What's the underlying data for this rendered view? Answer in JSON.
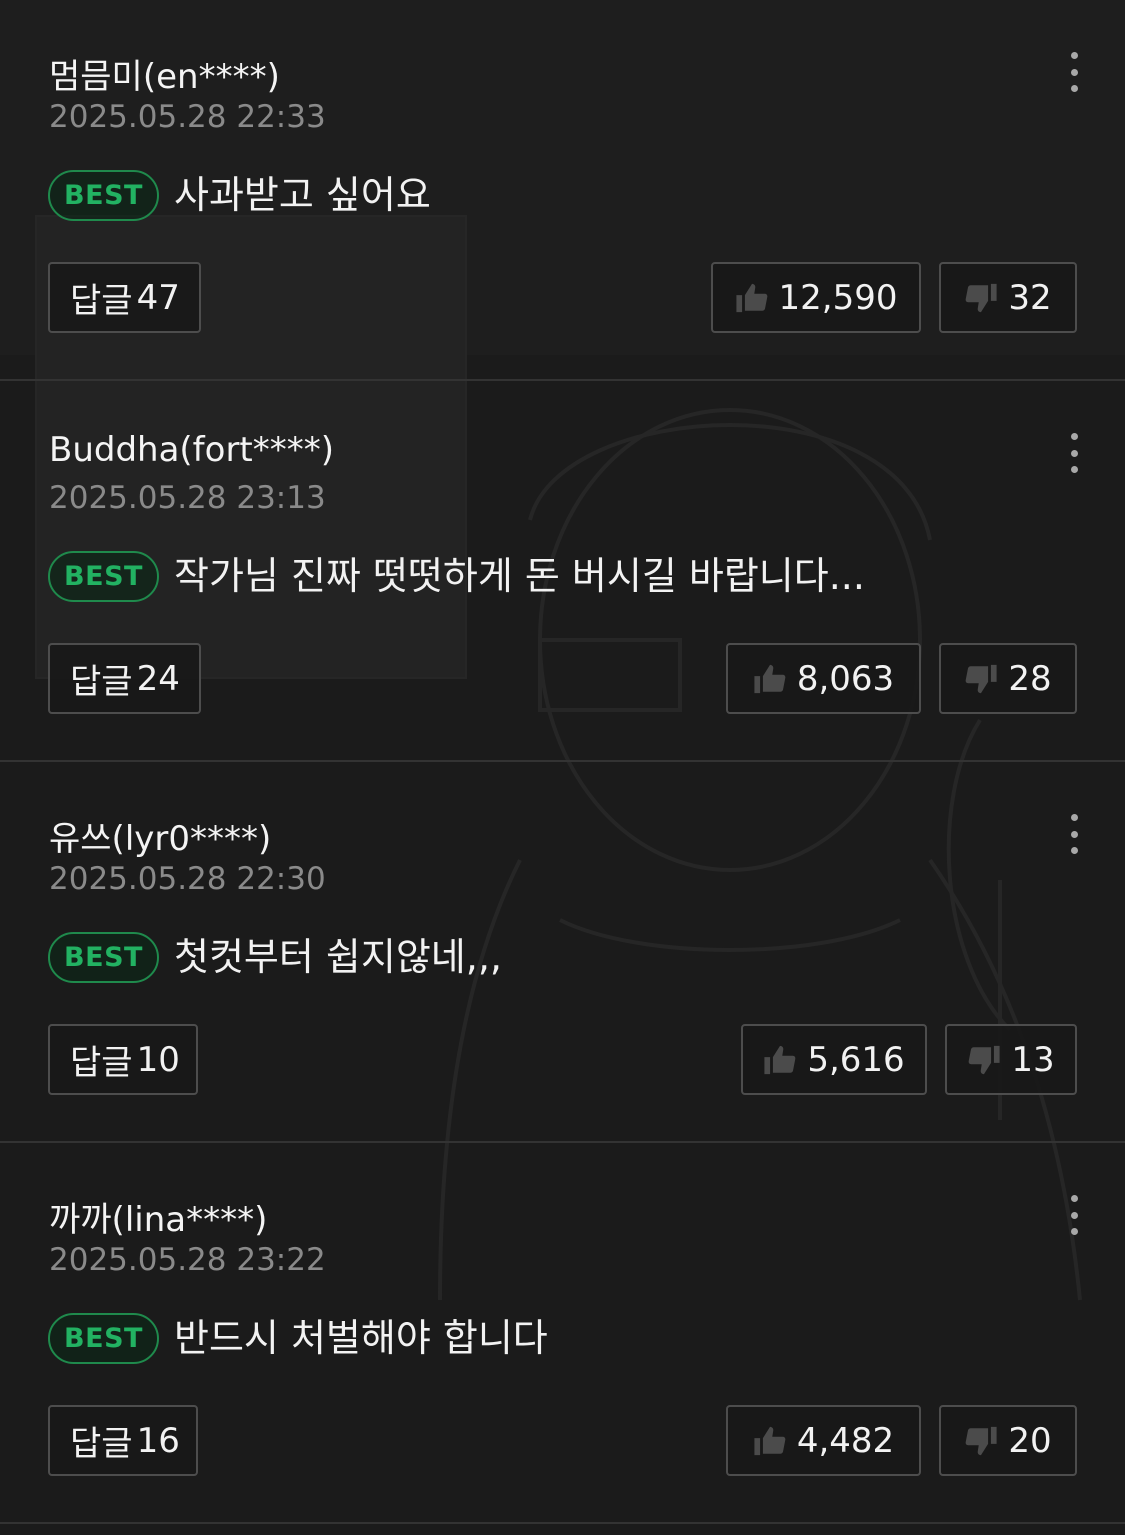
{
  "comments": [
    {
      "author": "멈믐미(en****)",
      "date": "2025.05.28 22:33",
      "badge": "BEST",
      "text": "사과받고 싶어요",
      "reply_label": "답글",
      "reply_count": "47",
      "likes": "12,590",
      "dislikes": "32"
    },
    {
      "author": "Buddha(fort****)",
      "date": "2025.05.28 23:13",
      "badge": "BEST",
      "text": "작가님 진짜 떳떳하게 돈 버시길 바랍니다...",
      "reply_label": "답글",
      "reply_count": "24",
      "likes": "8,063",
      "dislikes": "28"
    },
    {
      "author": "유쓰(lyr0****)",
      "date": "2025.05.28 22:30",
      "badge": "BEST",
      "text": "첫컷부터 쉽지않네,,,",
      "reply_label": "답글",
      "reply_count": "10",
      "likes": "5,616",
      "dislikes": "13"
    },
    {
      "author": "까까(lina****)",
      "date": "2025.05.28 23:22",
      "badge": "BEST",
      "text": "반드시 처벌해야 합니다",
      "reply_label": "답글",
      "reply_count": "16",
      "likes": "4,482",
      "dislikes": "20"
    }
  ],
  "icons": {
    "more": "more-vertical-icon",
    "like": "thumbs-up-icon",
    "dislike": "thumbs-down-icon"
  },
  "colors": {
    "background": "#1e1e1e",
    "best_badge": "#22b262",
    "date": "#8a8a8a",
    "button_border": "#4d4d4d"
  }
}
